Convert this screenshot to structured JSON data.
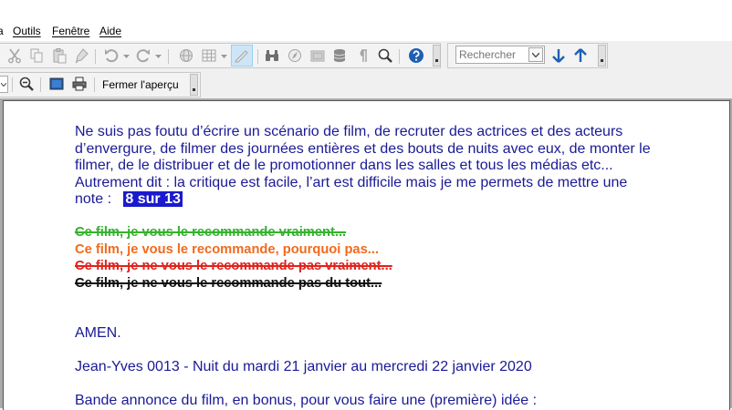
{
  "menu": {
    "items": [
      {
        "label": "Outils"
      },
      {
        "label": "Fenêtre"
      },
      {
        "label": "Aide"
      }
    ]
  },
  "toolbar": {
    "search_placeholder": "Rechercher",
    "search_value": "",
    "close_preview_label": "Fermer l'aperçu"
  },
  "document": {
    "paragraph_lines": [
      "Ne suis pas foutu d’écrire un scénario de film, de recruter des actrices et des acteurs",
      "d’envergure, de filmer des journées entières et des bouts de nuits avec eux, de monter le",
      "filmer, de le distribuer et de le promotionner dans les salles et tous les médias etc...",
      "Autrement dit : la critique est facile, l’art est difficile mais je me permets de mettre une"
    ],
    "note_label": "note :",
    "note_value": "8 sur 13",
    "verdicts": [
      {
        "text": "Ce film, je vous le recommande vraiment...",
        "color": "#35b22e",
        "strikethrough": true
      },
      {
        "text": "Ce film, je vous le recommande, pourquoi  pas...",
        "color": "#f26a1b",
        "strikethrough": false
      },
      {
        "text": "Ce film, je ne vous le recommande pas vraiment...",
        "color": "#e0231d",
        "strikethrough": true
      },
      {
        "text": "Ce film, je ne vous le recommande pas du tout...",
        "color": "#111111",
        "strikethrough": true
      }
    ],
    "amen": "AMEN.",
    "signature": "Jean-Yves 0013  -  Nuit du mardi 21 janvier au mercredi 22 janvier 2020",
    "trailer_line": "Bande annonce du film, en bonus, pour vous faire une (première) idée  :"
  },
  "colors": {
    "text_blue": "#1a1a96",
    "highlight": "#1a1acd"
  },
  "icons": {
    "toolbar1": [
      "cut-icon",
      "copy-icon",
      "paste-icon",
      "clone-format-icon",
      "undo-icon",
      "redo-icon",
      "hyperlink-icon",
      "table-icon",
      "draw-icon",
      "find-replace-icon",
      "navigator-icon",
      "gallery-icon",
      "database-icon",
      "formatting-marks-icon",
      "zoom-icon",
      "help-icon",
      "find-next-icon",
      "find-previous-icon"
    ],
    "toolbar2": [
      "zoom-out-icon",
      "fullscreen-icon",
      "print-icon"
    ]
  }
}
